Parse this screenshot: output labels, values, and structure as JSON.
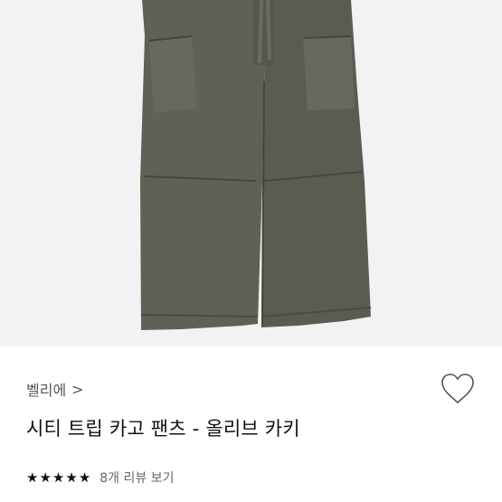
{
  "product": {
    "brand": "벨리에",
    "brand_chevron": ">",
    "title": "시티 트립 카고 팬츠 - 올리브 카키",
    "rating": 5,
    "stars": [
      "★",
      "★",
      "★",
      "★",
      "★"
    ],
    "review_link": "8개 리뷰 보기",
    "image_subject": "olive khaki cargo pants"
  },
  "icons": {
    "wishlist": "heart-outline-icon",
    "star": "star-icon"
  },
  "colors": {
    "pants": "#5f6157",
    "background": "#f2f2f2"
  }
}
